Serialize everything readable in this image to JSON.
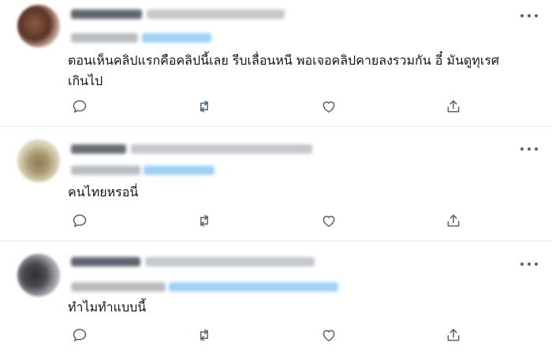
{
  "tweets": [
    {
      "text": "ตอนเห็นคลิปแรกคือคลิปนี้เลย รีบเลื่อนหนี พอเจอคลิปคายลงรวมกัน อี๋ มันดูทุเรศ\nเกินไป"
    },
    {
      "text": "คนไทยหรอนี่"
    },
    {
      "text": "ทำไมทำแบบนี้"
    }
  ],
  "icons": {
    "reply": "reply-icon",
    "retweet": "retweet-icon",
    "like": "like-icon",
    "share": "share-icon",
    "more": "more-icon"
  },
  "colors": {
    "text": "#0f1419",
    "icon": "#536471",
    "divider": "#e6ecf0",
    "link_blur": "#9fd0f5"
  }
}
